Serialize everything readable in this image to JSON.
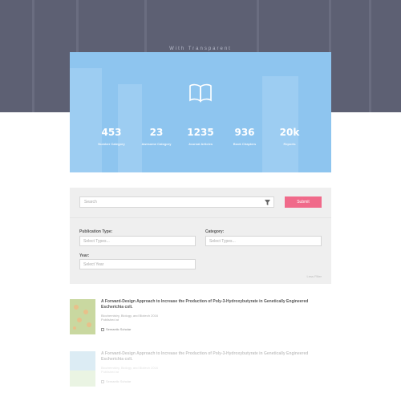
{
  "hero": {
    "caption": "With Transparent"
  },
  "stats": [
    {
      "value": "453",
      "label": "Number Category"
    },
    {
      "value": "23",
      "label": "Awesome Category"
    },
    {
      "value": "1235",
      "label": "Journal Articles"
    },
    {
      "value": "936",
      "label": "Book Chapters"
    },
    {
      "value": "20k",
      "label": "Reports"
    }
  ],
  "search": {
    "placeholder": "Search",
    "submit_label": "Submit"
  },
  "filters": {
    "publication_type": {
      "label": "Publication Type:",
      "placeholder": "Select Types..."
    },
    "category": {
      "label": "Category:",
      "placeholder": "Select Types..."
    },
    "year": {
      "label": "Year:",
      "placeholder": "Select Year"
    },
    "advanced_link": "Less Filter"
  },
  "results": [
    {
      "title": "A Forward-Design Approach to Increase the Production of Poly-3-Hydroxybutyrate in Genetically Engineered Escherichia coli.",
      "meta1": "Biochemistry, Biology, and Biotech 2016",
      "meta2": "Published at",
      "link": "Semantic Scholar"
    },
    {
      "title": "A Forward-Design Approach to Increase the Production of Poly-3-Hydroxybutyrate in Genetically Engineered Escherichia coli.",
      "meta1": "Biochemistry, Biology, and Biotech 2016",
      "meta2": "Published at",
      "link": "Semantic Scholar"
    }
  ],
  "colors": {
    "hero_bg": "#5d6073",
    "stats_bg": "#8ec5ef",
    "accent": "#f06a8a",
    "panel_bg": "#efefef"
  }
}
